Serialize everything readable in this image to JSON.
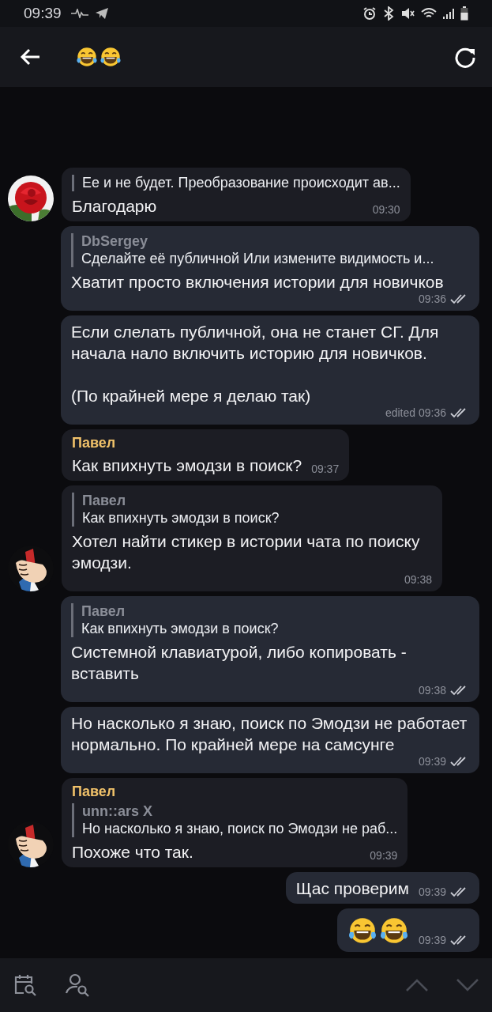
{
  "status_bar": {
    "time": "09:39"
  },
  "header": {
    "title": [
      {
        "kind": "laughing"
      },
      {
        "kind": "laughing"
      }
    ]
  },
  "messages": [
    {
      "kind": "incoming",
      "reply": {
        "text": "Ее и не будет. Преобразование происходит ав..."
      },
      "text": "Благодарю",
      "time": "09:30"
    },
    {
      "kind": "outgoing",
      "reply": {
        "author": "DbSergey",
        "text": "Сделайте её публичной Или измените видимость и..."
      },
      "text": "Хватит просто включения истории для новичков",
      "time": "09:36",
      "read": true
    },
    {
      "kind": "outgoing",
      "text": "Если слелать публичной, она не станет СГ. Для начала нало включить историю для новичков.\n\n(По крайней мере я делаю так)",
      "time": "edited 09:36",
      "read": true
    },
    {
      "kind": "incoming",
      "sender": "Павел",
      "text": "Как впихнуть эмодзи в поиск?",
      "time": "09:37"
    },
    {
      "kind": "incoming",
      "reply": {
        "author": "Павел",
        "text": "Как впихнуть эмодзи в поиск?"
      },
      "text": "Хотел найти стикер в истории чата по поиску эмодзи.",
      "time": "09:38"
    },
    {
      "kind": "outgoing",
      "reply": {
        "author": "Павел",
        "text": "Как впихнуть эмодзи в поиск?"
      },
      "text": "Системной клавиатурой, либо копировать - вставить",
      "time": "09:38",
      "read": true
    },
    {
      "kind": "outgoing",
      "text": "Но насколько я знаю, поиск по Эмодзи не работает нормально. По крайней мере на самсунге",
      "time": "09:39",
      "read": true
    },
    {
      "kind": "incoming",
      "sender": "Павел",
      "reply": {
        "author": "unn::ars X",
        "text": "Но насколько я знаю, поиск по Эмодзи не раб..."
      },
      "text": "Похоже что так.",
      "time": "09:39"
    },
    {
      "kind": "outgoing",
      "text": "Щас проверим",
      "time": "09:39",
      "read": true
    },
    {
      "kind": "outgoing",
      "emoji": [
        {
          "kind": "laughing"
        },
        {
          "kind": "laughing"
        }
      ],
      "time": "09:39",
      "read": true
    }
  ]
}
